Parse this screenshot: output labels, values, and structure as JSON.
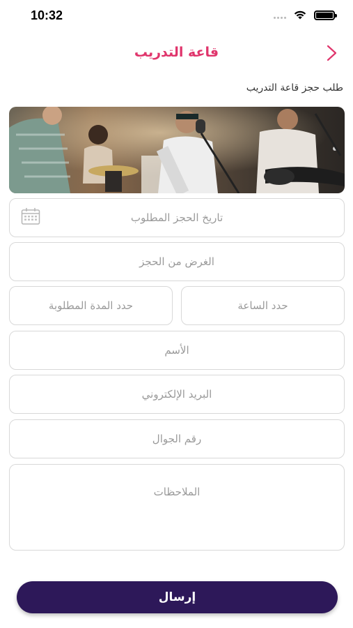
{
  "status_bar": {
    "time": "10:32"
  },
  "header": {
    "title": "قاعة التدريب"
  },
  "form": {
    "heading": "طلب حجز قاعة التدريب",
    "date_placeholder": "تاريخ الحجز المطلوب",
    "purpose_placeholder": "الغرض من الحجز",
    "hour_placeholder": "حدد الساعة",
    "duration_placeholder": "حدد المدة المطلوبة",
    "name_placeholder": "الأسم",
    "email_placeholder": "البريد الإلكتروني",
    "mobile_placeholder": "رقم الجوال",
    "notes_placeholder": "الملاحظات",
    "submit_label": "إرسال"
  },
  "colors": {
    "accent": "#e0356c",
    "button": "#2d1859",
    "border": "#d8d8d8",
    "placeholder": "#9a9a9a"
  },
  "icons": {
    "back": "chevron-icon",
    "date": "calendar-icon",
    "wifi": "wifi-icon",
    "battery": "battery-icon"
  }
}
